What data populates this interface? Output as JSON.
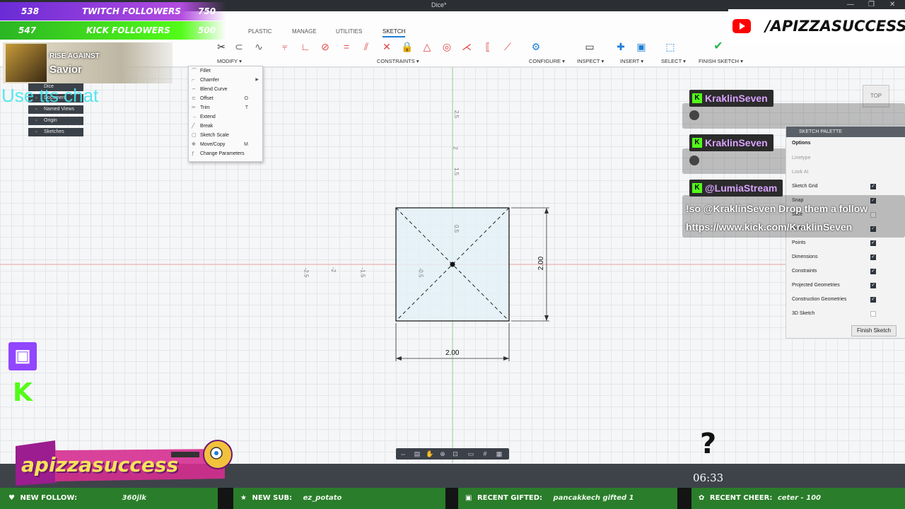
{
  "window": {
    "title": "Dice*",
    "controls": [
      "—",
      "❐",
      "✕"
    ]
  },
  "ribbon": {
    "tabs": [
      "PLASTIC",
      "MANAGE",
      "UTILITIES",
      "SKETCH"
    ],
    "active_tab": "SKETCH",
    "groups": [
      "MODIFY ▾",
      "CONSTRAINTS ▾",
      "CONFIGURE ▾",
      "INSPECT ▾",
      "INSERT ▾",
      "SELECT ▾",
      "FINISH SKETCH ▾"
    ]
  },
  "overlays": {
    "twitch_followers": {
      "count": "538",
      "label": "TWITCH FOLLOWERS",
      "goal": "750"
    },
    "kick_followers": {
      "count": "547",
      "label": "KICK FOLLOWERS",
      "goal": "500"
    },
    "youtube_handle": "/APIZZASUCCESS",
    "music": {
      "artist": "RISE AGAINST",
      "track": "Savior"
    },
    "tts_hint": "Use tts chat",
    "brand": "apizzasuccess",
    "timer": "06:33",
    "question_mark": "?",
    "twitch_icon": "twitch-icon",
    "kick_icon": "K"
  },
  "browser": {
    "items": [
      {
        "label": "Dice"
      },
      {
        "label": "Document Settings"
      },
      {
        "label": "Named Views"
      },
      {
        "label": "Origin"
      },
      {
        "label": "Sketches"
      }
    ]
  },
  "modify_menu": {
    "items": [
      {
        "label": "Fillet",
        "shortcut": "",
        "submenu": false
      },
      {
        "label": "Chamfer",
        "shortcut": "",
        "submenu": true
      },
      {
        "label": "Blend Curve",
        "shortcut": "",
        "submenu": false
      },
      {
        "label": "Offset",
        "shortcut": "O",
        "submenu": false
      },
      {
        "label": "Trim",
        "shortcut": "T",
        "submenu": false
      },
      {
        "label": "Extend",
        "shortcut": "",
        "submenu": false
      },
      {
        "label": "Break",
        "shortcut": "",
        "submenu": false
      },
      {
        "label": "Sketch Scale",
        "shortcut": "",
        "submenu": false
      },
      {
        "label": "Move/Copy",
        "shortcut": "M",
        "submenu": false
      },
      {
        "label": "Change Parameters",
        "shortcut": "",
        "submenu": false
      }
    ]
  },
  "sketch": {
    "dimension_width": "2.00",
    "dimension_height": "2.00",
    "axis_labels_y": [
      "2.5",
      "2",
      "1.5",
      "0.5"
    ],
    "axis_labels_x": [
      "-2.5",
      "-2",
      "-1.5",
      "-0.5"
    ]
  },
  "viewcube": {
    "label": "TOP"
  },
  "chat": [
    {
      "user": "KraklinSeven",
      "message": ""
    },
    {
      "user": "KraklinSeven",
      "message": ""
    },
    {
      "user": "@LumiaStream",
      "message": "!so @KraklinSeven Drop them a follow https://www.kick.com/KraklinSeven"
    }
  ],
  "palette": {
    "title": "SKETCH PALETTE",
    "section": "Options",
    "options": [
      {
        "label": "Linetype",
        "checked": false
      },
      {
        "label": "Look At",
        "checked": false
      },
      {
        "label": "Sketch Grid",
        "checked": true
      },
      {
        "label": "Snap",
        "checked": true
      },
      {
        "label": "Slice",
        "checked": false
      },
      {
        "label": "Profile",
        "checked": true
      },
      {
        "label": "Points",
        "checked": true
      },
      {
        "label": "Dimensions",
        "checked": true
      },
      {
        "label": "Constraints",
        "checked": true
      },
      {
        "label": "Projected Geometries",
        "checked": true
      },
      {
        "label": "Construction Geometries",
        "checked": true
      },
      {
        "label": "3D Sketch",
        "checked": false
      }
    ],
    "finish_button": "Finish Sketch"
  },
  "ticker": {
    "new_follow": {
      "label": "NEW FOLLOW:",
      "value": "360jlk"
    },
    "new_sub": {
      "label": "NEW SUB:",
      "value": "ez_potato"
    },
    "recent_gifted": {
      "label": "RECENT GIFTED:",
      "value": "pancakkech gifted 1"
    },
    "recent_cheer": {
      "label": "RECENT CHEER:",
      "value": "ceter - 100"
    }
  },
  "colors": {
    "accent": "#1c7ed6",
    "kick_green": "#53fc18",
    "twitch_purple": "#9146ff",
    "chat_name": "#d9a2ff"
  }
}
